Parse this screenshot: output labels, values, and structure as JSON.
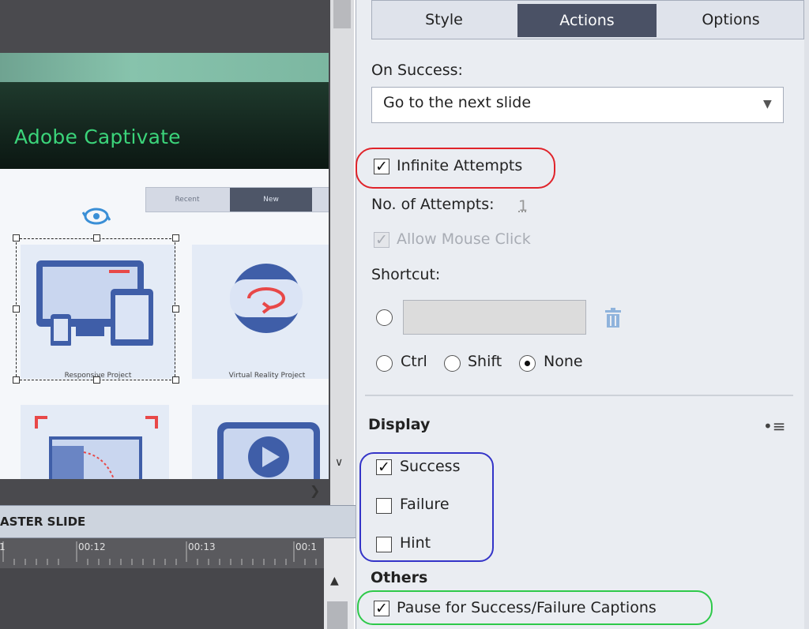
{
  "stage": {
    "banner_title": "Adobe Captivate",
    "mini_tabs": [
      "Recent",
      "New"
    ],
    "cards": [
      {
        "label": "Responsive Project"
      },
      {
        "label": "Virtual Reality Project"
      }
    ]
  },
  "timeline": {
    "header_label": "ASTER SLIDE",
    "ticks": [
      "1",
      "00:12",
      "00:13",
      "00:1"
    ]
  },
  "panel": {
    "tabs": {
      "style": "Style",
      "actions": "Actions",
      "options": "Options"
    },
    "active_tab": "Actions",
    "on_success_label": "On Success:",
    "on_success_value": "Go to the next slide",
    "infinite_attempts": {
      "label": "Infinite Attempts",
      "checked": true
    },
    "no_of_attempts_label": "No. of Attempts:",
    "no_of_attempts_value": "1",
    "allow_mouse_click": {
      "label": "Allow Mouse Click",
      "checked": true,
      "disabled": true
    },
    "shortcut_label": "Shortcut:",
    "modifiers": [
      {
        "label": "Ctrl",
        "selected": false
      },
      {
        "label": "Shift",
        "selected": false
      },
      {
        "label": "None",
        "selected": true
      }
    ],
    "display_heading": "Display",
    "display_options": [
      {
        "label": "Success",
        "checked": true
      },
      {
        "label": "Failure",
        "checked": false
      },
      {
        "label": "Hint",
        "checked": false
      }
    ],
    "others_heading": "Others",
    "pause_captions": {
      "label": "Pause for Success/Failure Captions",
      "checked": true
    }
  },
  "colors": {
    "active_tab_bg": "#4a5165",
    "highlight_red": "#e0232a",
    "highlight_blue": "#3434c8",
    "highlight_green": "#2ec94a",
    "banner_text": "#3bd47a"
  }
}
